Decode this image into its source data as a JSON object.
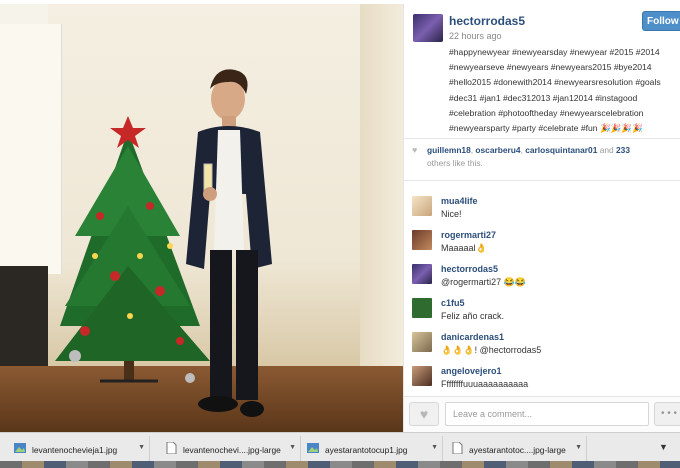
{
  "post": {
    "username": "hectorrodas5",
    "timestamp": "22 hours ago",
    "follow_label": "Follow",
    "caption": "#happynewyear #newyearsday #newyear #2015 #2014 #newyearseve #newyears #newyears2015 #bye2014 #hello2015 #donewith2014 #newyearsresolution #goals #dec31 #jan1 #dec312013 #jan12014 #instagood #celebration #photooftheday #newyearscelebration #newyearsparty #party #celebrate #fun 🎉🎉🎉🎉"
  },
  "likes": {
    "likers": [
      "guillemn18",
      "oscarberu4",
      "carlosquintanar01"
    ],
    "and_text": "and",
    "count": "233",
    "others_text": "others like this."
  },
  "comments": [
    {
      "user": "mua4life",
      "text": "Nice!"
    },
    {
      "user": "rogermarti27",
      "text": "Maaaaal👌"
    },
    {
      "user": "hectorrodas5",
      "text": "@rogermarti27 😂😂"
    },
    {
      "user": "c1fu5",
      "text": "Feliz año crack."
    },
    {
      "user": "danicardenas1",
      "text": "👌👌👌! @hectorrodas5"
    },
    {
      "user": "angelovejero1",
      "text": "Ffffffffuuuaaaaaaaaaa"
    }
  ],
  "comment_input": {
    "placeholder": "Leave a comment..."
  },
  "more_label": "• • •",
  "downloads": [
    {
      "name": "levantenochevieja1.jpg",
      "type": "image"
    },
    {
      "name": "levantenochevi....jpg-large",
      "type": "file"
    },
    {
      "name": "ayestarantotocup1.jpg",
      "type": "image"
    },
    {
      "name": "ayestarantotoc....jpg-large",
      "type": "file"
    }
  ],
  "show_all_label": "▼"
}
